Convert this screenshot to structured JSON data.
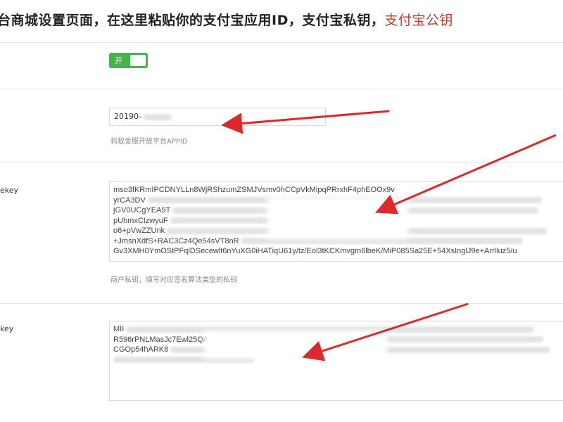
{
  "header": {
    "instruction": "台商城设置页面，在这里粘贴你的支付宝应用ID，支付宝私钥，",
    "highlight": "支付宝公钥",
    "highlight_color": "#c0392b"
  },
  "toggle": {
    "label": "开",
    "state": "on",
    "color": "#44b549"
  },
  "appid": {
    "value": "20190-",
    "hint": "蚂蚁金服开放平台APPID"
  },
  "private_key": {
    "side_label": "ekey",
    "lines": [
      "mso3fKRmIPCDNYLLn8WjRShzumZSMJVsmv0hCCpVkMipqPRrxhF4phEOOx9v",
      "yrCA3DV",
      "jGV0UCgYEA9T",
      "pUhmxCIzwyuF",
      "o6+pVwZZUnk",
      "+JmsnXdfS+RAC3Cz4Qe54sVT8nR",
      "Gv3XMH0YmOStPFqlDSecewlt6nYuXG0iHATiqU61y/tz/Eol3tKCKmvgm6lbeK/MiP085Sa25E+54XsInglJ9e+Arrlluz5/u"
    ],
    "hint": "商户私钥，填写对应签名算法类型的私钥"
  },
  "public_key": {
    "side_label": "key",
    "lines": [
      "MII",
      "R596rPNLMasJc7Ewl25QAztbJmX4",
      "CGOp54hARK8"
    ]
  }
}
